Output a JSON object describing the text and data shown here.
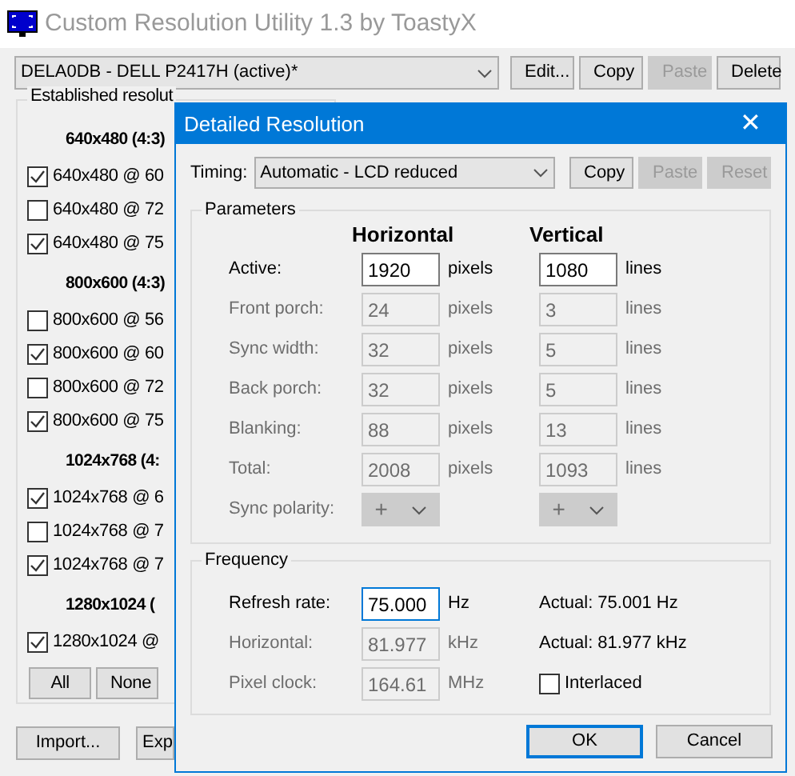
{
  "window": {
    "title": "Custom Resolution Utility 1.3 by ToastyX"
  },
  "monitor": {
    "value": "DELA0DB - DELL P2417H (active)*"
  },
  "top_buttons": [
    {
      "label": "Edit...",
      "disabled": false
    },
    {
      "label": "Copy",
      "disabled": false
    },
    {
      "label": "Paste",
      "disabled": true
    },
    {
      "label": "Delete",
      "disabled": false
    }
  ],
  "established": {
    "title": "Established resolut",
    "groups": [
      {
        "heading": "640x480 (4:3)",
        "items": [
          {
            "label": "640x480 @ 60",
            "checked": true
          },
          {
            "label": "640x480 @ 72",
            "checked": false
          },
          {
            "label": "640x480 @ 75",
            "checked": true
          }
        ]
      },
      {
        "heading": "800x600 (4:3)",
        "items": [
          {
            "label": "800x600 @ 56",
            "checked": false
          },
          {
            "label": "800x600 @ 60",
            "checked": true
          },
          {
            "label": "800x600 @ 72",
            "checked": false
          },
          {
            "label": "800x600 @ 75",
            "checked": true
          }
        ]
      },
      {
        "heading": "1024x768 (4:",
        "items": [
          {
            "label": "1024x768 @ 6",
            "checked": true
          },
          {
            "label": "1024x768 @ 7",
            "checked": false
          },
          {
            "label": "1024x768 @ 7",
            "checked": true
          }
        ]
      },
      {
        "heading": "1280x1024 (",
        "items": [
          {
            "label": "1280x1024 @",
            "checked": true
          }
        ]
      }
    ],
    "buttons": [
      "All",
      "None"
    ]
  },
  "bottom_buttons": [
    "Import...",
    "Exp"
  ],
  "dialog": {
    "title": "Detailed Resolution",
    "close": "✕",
    "timing": {
      "label": "Timing:",
      "value": "Automatic - LCD reduced"
    },
    "timing_buttons": [
      {
        "label": "Copy",
        "disabled": false
      },
      {
        "label": "Paste",
        "disabled": true
      },
      {
        "label": "Reset",
        "disabled": true
      }
    ],
    "parameters": {
      "title": "Parameters",
      "column_headers": [
        "Horizontal",
        "Vertical"
      ],
      "rows": [
        {
          "kind": "field",
          "label": "Active:",
          "disabled": false,
          "h_value": "1920",
          "h_unit": "pixels",
          "v_value": "1080",
          "v_unit": "lines"
        },
        {
          "kind": "field",
          "label": "Front porch:",
          "disabled": true,
          "h_value": "24",
          "h_unit": "pixels",
          "v_value": "3",
          "v_unit": "lines"
        },
        {
          "kind": "field",
          "label": "Sync width:",
          "disabled": true,
          "h_value": "32",
          "h_unit": "pixels",
          "v_value": "5",
          "v_unit": "lines"
        },
        {
          "kind": "field",
          "label": "Back porch:",
          "disabled": true,
          "h_value": "32",
          "h_unit": "pixels",
          "v_value": "5",
          "v_unit": "lines"
        },
        {
          "kind": "field",
          "label": "Blanking:",
          "disabled": true,
          "h_value": "88",
          "h_unit": "pixels",
          "v_value": "13",
          "v_unit": "lines"
        },
        {
          "kind": "field",
          "label": "Total:",
          "disabled": true,
          "h_value": "2008",
          "h_unit": "pixels",
          "v_value": "1093",
          "v_unit": "lines"
        },
        {
          "kind": "select",
          "label": "Sync polarity:",
          "disabled": true,
          "h_value": "+",
          "v_value": "+"
        }
      ]
    },
    "frequency": {
      "title": "Frequency",
      "rows": [
        {
          "kind": "field",
          "label": "Refresh rate:",
          "disabled": false,
          "value": "75.000",
          "unit": "Hz",
          "actual": "Actual: 75.001 Hz"
        },
        {
          "kind": "field",
          "label": "Horizontal:",
          "disabled": true,
          "value": "81.977",
          "unit": "kHz",
          "actual": "Actual: 81.977 kHz"
        },
        {
          "kind": "field",
          "label": "Pixel clock:",
          "disabled": true,
          "value": "164.61",
          "unit": "MHz"
        }
      ],
      "interlaced": {
        "label": "Interlaced",
        "checked": false
      }
    },
    "buttons": [
      {
        "label": "OK",
        "default": true
      },
      {
        "label": "Cancel",
        "default": false
      }
    ]
  }
}
